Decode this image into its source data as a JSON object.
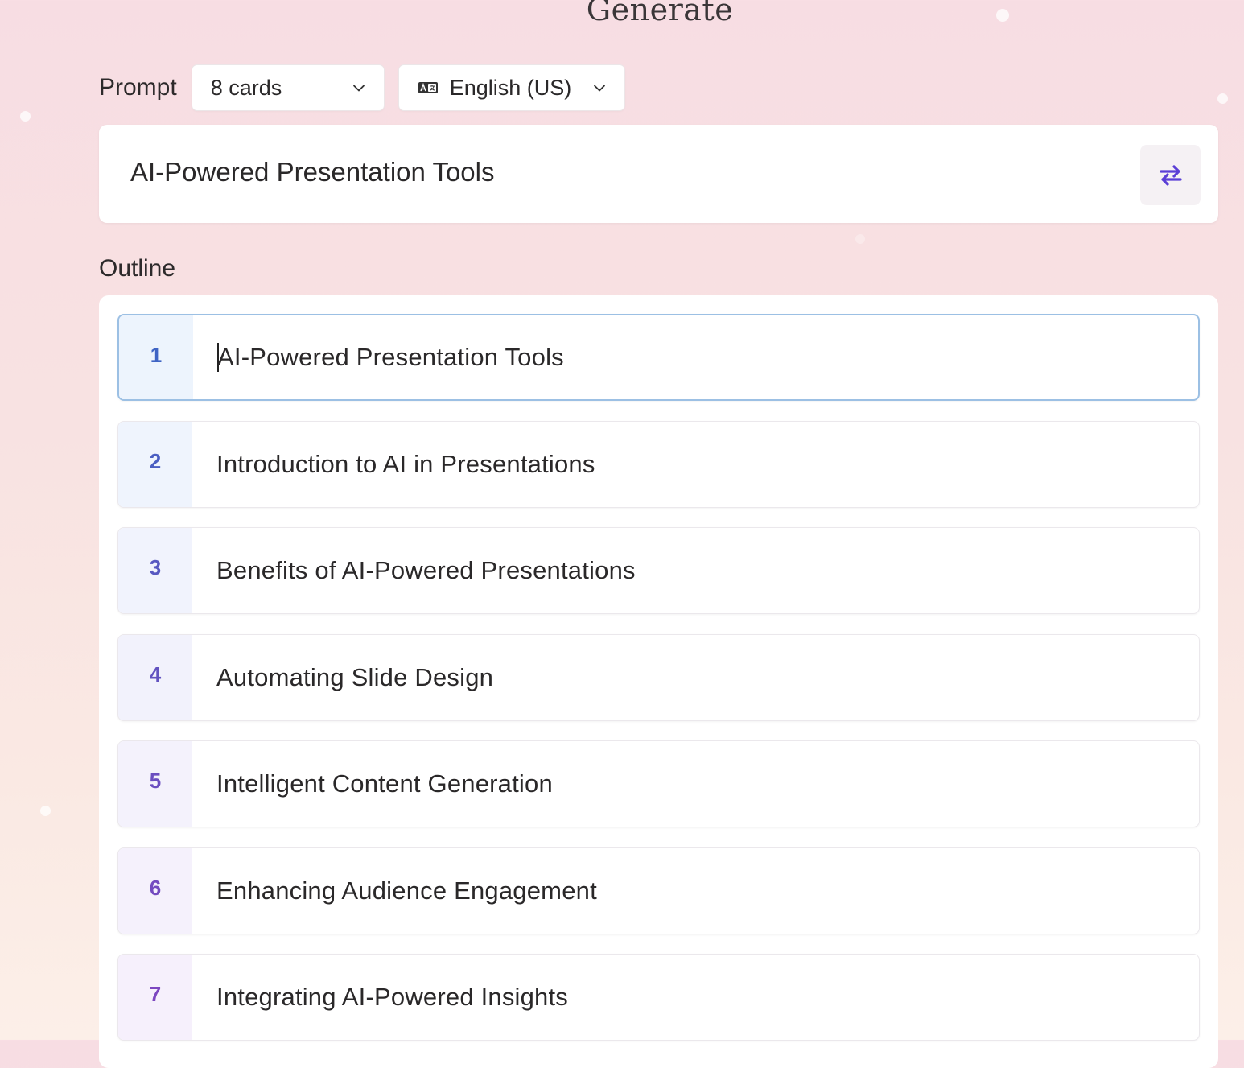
{
  "header": {
    "title": "Generate"
  },
  "prompt_bar": {
    "label": "Prompt",
    "cards_select": "8 cards",
    "language_select": "English (US)",
    "language_icon": "translate-icon"
  },
  "prompt": {
    "text": "AI-Powered Presentation Tools",
    "shuffle_icon": "shuffle-icon"
  },
  "outline": {
    "label": "Outline",
    "items": [
      {
        "num": "1",
        "title": "AI-Powered Presentation Tools"
      },
      {
        "num": "2",
        "title": "Introduction to AI in Presentations"
      },
      {
        "num": "3",
        "title": "Benefits of AI-Powered Presentations"
      },
      {
        "num": "4",
        "title": "Automating Slide Design"
      },
      {
        "num": "5",
        "title": "Intelligent Content Generation"
      },
      {
        "num": "6",
        "title": "Enhancing Audience Engagement"
      },
      {
        "num": "7",
        "title": "Integrating AI-Powered Insights"
      }
    ]
  },
  "colors": {
    "accent": "#5b3fd6",
    "active_border": "#9cc0e4",
    "number_gradient": [
      "#3f64c4",
      "#4a5ec2",
      "#5758c1",
      "#6252c0",
      "#6b4fc0",
      "#744bc0",
      "#7d47c0"
    ],
    "number_bg_gradient": [
      "#edf4fd",
      "#eff4fd",
      "#f1f3fd",
      "#f2f2fc",
      "#f4f2fc",
      "#f5f1fc",
      "#f6f0fc"
    ]
  }
}
